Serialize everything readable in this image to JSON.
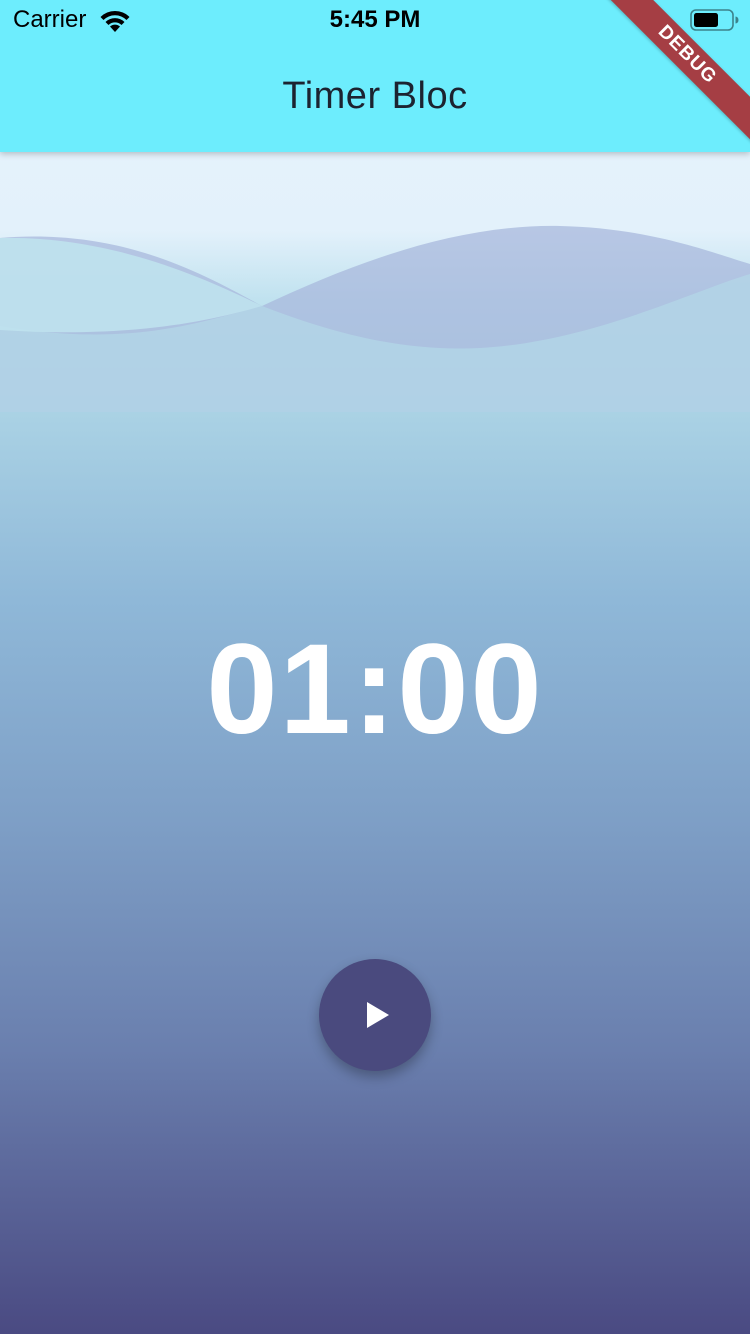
{
  "status_bar": {
    "carrier": "Carrier",
    "time": "5:45 PM",
    "wifi_icon": "wifi-icon",
    "battery_icon": "battery-icon"
  },
  "app_bar": {
    "title": "Timer Bloc",
    "color": "#6dedfd"
  },
  "debug_banner": {
    "label": "DEBUG",
    "color": "#a53e44"
  },
  "timer": {
    "display": "01:00"
  },
  "controls": {
    "play_icon": "play-icon",
    "button_color": "#4a4a7e"
  },
  "background": {
    "gradient_top": "#e6f3fc",
    "gradient_bottom": "#4a4a82"
  }
}
